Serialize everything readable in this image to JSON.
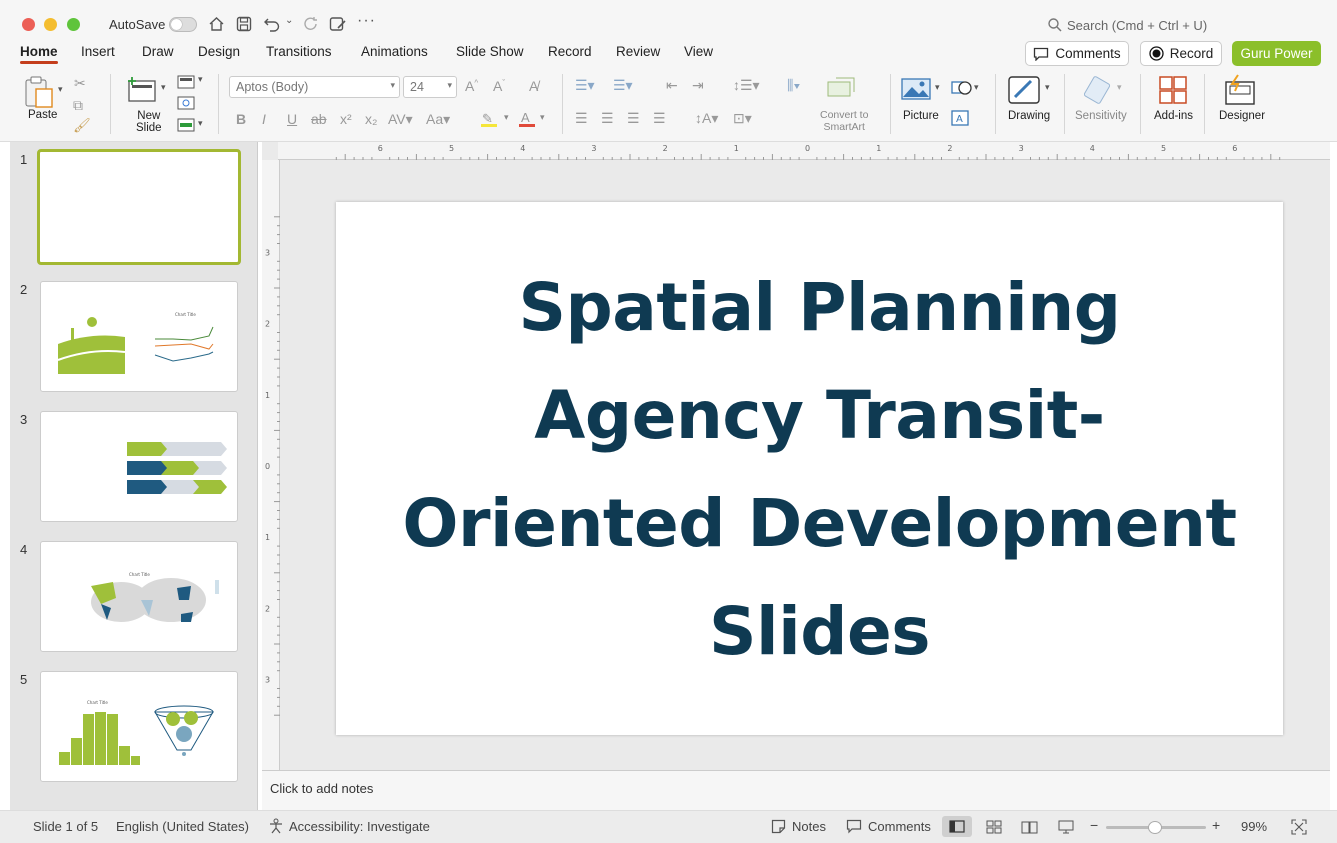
{
  "window": {
    "autosave_label": "AutoSave",
    "search_placeholder": "Search (Cmd + Ctrl + U)"
  },
  "tabs": [
    "Home",
    "Insert",
    "Draw",
    "Design",
    "Transitions",
    "Animations",
    "Slide Show",
    "Record",
    "Review",
    "View"
  ],
  "header_buttons": {
    "comments": "Comments",
    "record": "Record",
    "guru": "Guru Power"
  },
  "ribbon": {
    "paste": "Paste",
    "new_slide_1": "New",
    "new_slide_2": "Slide",
    "font_name": "Aptos (Body)",
    "font_size": "24",
    "convert_1": "Convert to",
    "convert_2": "SmartArt",
    "picture": "Picture",
    "drawing": "Drawing",
    "sensitivity": "Sensitivity",
    "addins": "Add-ins",
    "designer": "Designer"
  },
  "thumbnails": [
    "1",
    "2",
    "3",
    "4",
    "5"
  ],
  "thumb_text": {
    "chart_title": "Chart Title"
  },
  "ruler_h": [
    "6",
    "5",
    "4",
    "3",
    "2",
    "1",
    "0",
    "1",
    "2",
    "3",
    "4",
    "5",
    "6"
  ],
  "ruler_v": [
    "3",
    "2",
    "1",
    "0",
    "1",
    "2",
    "3"
  ],
  "slide": {
    "title_lines": [
      "Spatial Planning",
      "Agency Transit-",
      "Oriented Development",
      "Slides"
    ]
  },
  "notes_placeholder": "Click to add notes",
  "status": {
    "slide_of": "Slide 1 of 5",
    "language": "English (United States)",
    "accessibility": "Accessibility: Investigate",
    "notes": "Notes",
    "comments": "Comments",
    "zoom_minus": "−",
    "zoom_plus": "+",
    "zoom": "99%"
  },
  "colors": {
    "accent_red": "#c43e1c",
    "title_navy": "#0f3a52",
    "guru_green": "#8bbf2a",
    "selected_border": "#a3b832"
  }
}
